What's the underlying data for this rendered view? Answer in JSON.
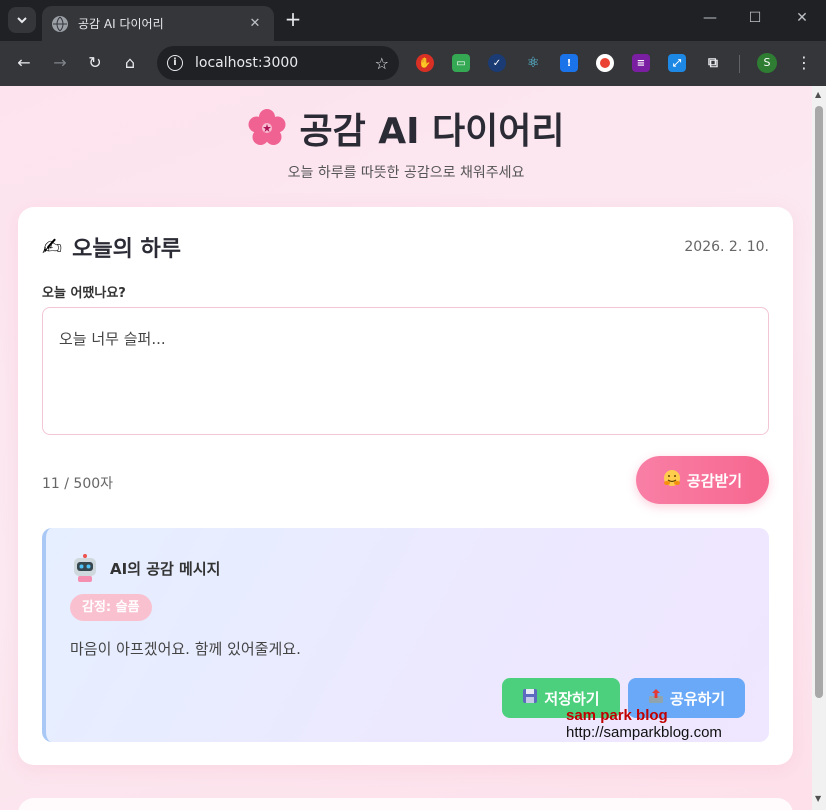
{
  "browser": {
    "tab_title": "공감 AI 다이어리",
    "url": "localhost:3000",
    "profile_initial": "S",
    "new_tab": "+",
    "tab_close": "✕"
  },
  "page": {
    "title": "공감 AI 다이어리",
    "subtitle": "오늘 하루를 따뜻한 공감으로 채워주세요"
  },
  "diary": {
    "heading": "오늘의 하루",
    "date": "2026. 2. 10.",
    "question": "오늘 어땠나요?",
    "input_value": "오늘 너무 슬퍼...",
    "char_count": "11 / 500자",
    "submit_label": "공감받기"
  },
  "ai": {
    "heading": "AI의 공감 메시지",
    "emotion_badge": "감정: 슬픔",
    "message": "마음이 아프겠어요. 함께 있어줄게요.",
    "save_label": "저장하기",
    "share_label": "공유하기"
  },
  "watermark": {
    "line1": "sam park blog",
    "line2": "http://samparkblog.com"
  },
  "colors": {
    "primary_pink": "#f6678f",
    "save_green": "#4cd07d",
    "share_blue": "#6aa9f7",
    "badge_pink": "#f9c1d0"
  }
}
